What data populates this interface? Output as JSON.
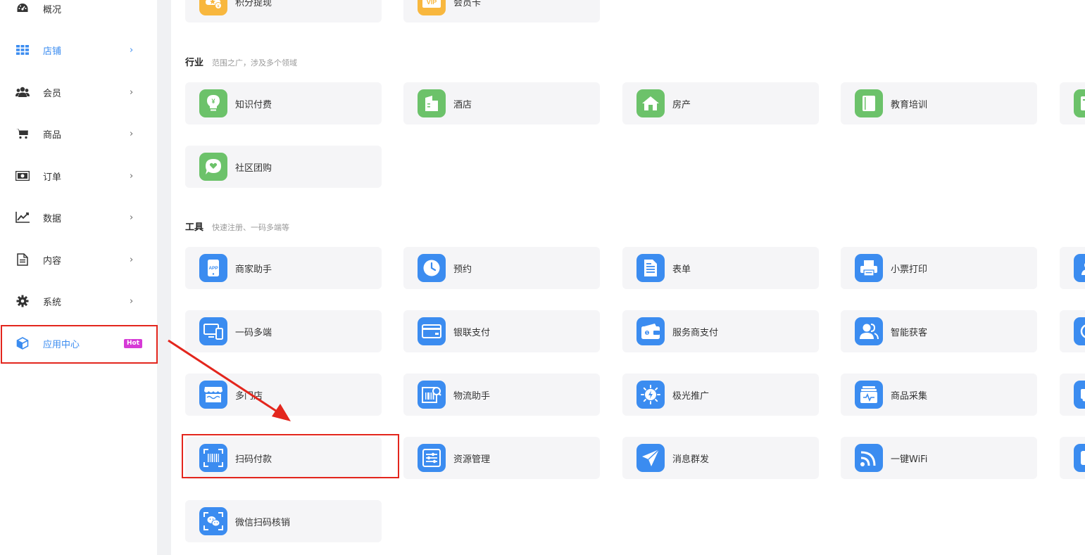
{
  "colors": {
    "accent": "#3b8cf0",
    "industry_icon_bg": "#6cc26a",
    "tool_icon_bg": "#3b8cf0",
    "top_icon_bg": "#f8b73e",
    "hot_badge": "#d63ad6",
    "annotation": "#e3261d"
  },
  "sidebar": {
    "items": [
      {
        "label": "概况",
        "icon": "dashboard-icon"
      },
      {
        "label": "店铺",
        "icon": "grid-icon",
        "active": true
      },
      {
        "label": "会员",
        "icon": "users-icon"
      },
      {
        "label": "商品",
        "icon": "cart-icon"
      },
      {
        "label": "订单",
        "icon": "money-icon"
      },
      {
        "label": "数据",
        "icon": "chart-icon"
      },
      {
        "label": "内容",
        "icon": "document-icon"
      },
      {
        "label": "系统",
        "icon": "gear-icon"
      },
      {
        "label": "应用中心",
        "icon": "cube-icon",
        "badge": "Hot"
      }
    ],
    "chevron": "›"
  },
  "top_row": [
    {
      "label": "积分提现",
      "icon": "points-icon"
    },
    {
      "label": "会员卡",
      "icon": "vip-card-icon",
      "icon_text": "VIP"
    }
  ],
  "industry": {
    "title": "行业",
    "subtitle": "范围之广，涉及多个领域",
    "cards": [
      {
        "label": "知识付费",
        "icon": "lightbulb-icon"
      },
      {
        "label": "酒店",
        "icon": "hotel-icon"
      },
      {
        "label": "房产",
        "icon": "house-icon"
      },
      {
        "label": "教育培训",
        "icon": "book-icon"
      },
      {
        "label": "社区团购",
        "icon": "heart-bubble-icon"
      }
    ]
  },
  "tools": {
    "title": "工具",
    "subtitle": "快速注册、一码多端等",
    "cards": [
      {
        "label": "商家助手",
        "icon": "app-phone-icon"
      },
      {
        "label": "预约",
        "icon": "clock-icon"
      },
      {
        "label": "表单",
        "icon": "form-icon"
      },
      {
        "label": "小票打印",
        "icon": "printer-icon"
      },
      {
        "label": "一码多端",
        "icon": "devices-icon"
      },
      {
        "label": "银联支付",
        "icon": "card-icon"
      },
      {
        "label": "服务商支付",
        "icon": "wallet-icon"
      },
      {
        "label": "智能获客",
        "icon": "people-icon"
      },
      {
        "label": "多门店",
        "icon": "store-icon"
      },
      {
        "label": "物流助手",
        "icon": "logistics-icon"
      },
      {
        "label": "极光推广",
        "icon": "aurora-icon"
      },
      {
        "label": "商品采集",
        "icon": "collect-icon"
      },
      {
        "label": "扫码付款",
        "icon": "barcode-scan-icon"
      },
      {
        "label": "资源管理",
        "icon": "sliders-icon"
      },
      {
        "label": "消息群发",
        "icon": "send-icon"
      },
      {
        "label": "一键WiFi",
        "icon": "wifi-icon"
      },
      {
        "label": "微信扫码核销",
        "icon": "wechat-scan-icon"
      }
    ]
  }
}
